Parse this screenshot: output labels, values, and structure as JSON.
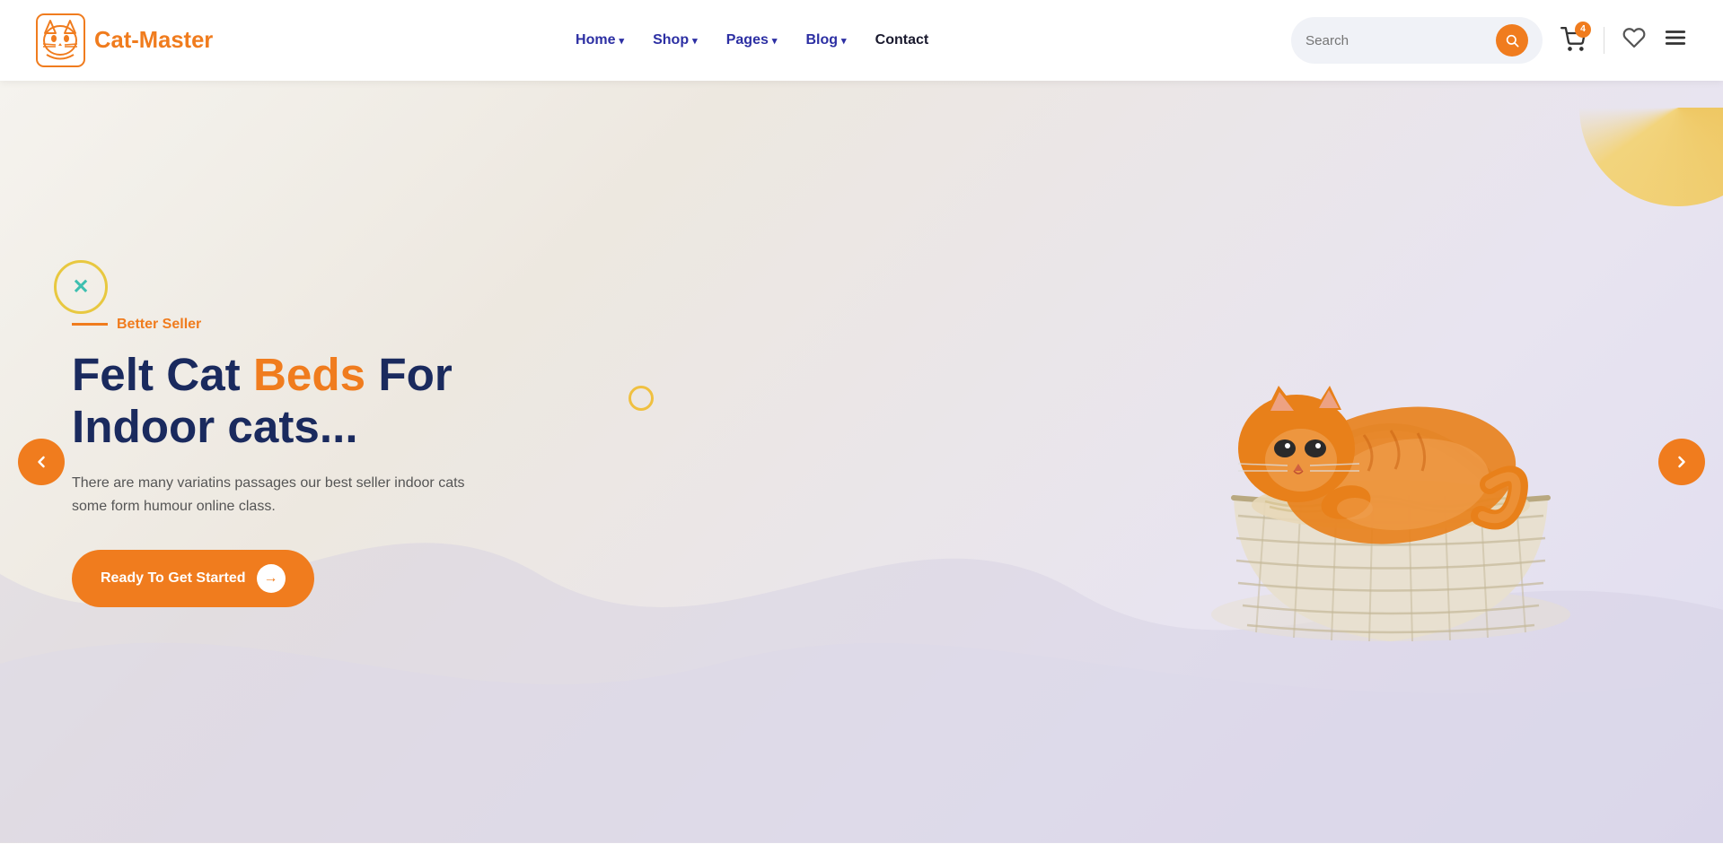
{
  "header": {
    "logo_text": "Cat-Master",
    "nav_items": [
      {
        "label": "Home",
        "has_dropdown": true
      },
      {
        "label": "Shop",
        "has_dropdown": true
      },
      {
        "label": "Pages",
        "has_dropdown": true
      },
      {
        "label": "Blog",
        "has_dropdown": true
      },
      {
        "label": "Contact",
        "has_dropdown": false
      }
    ],
    "search_placeholder": "Search",
    "cart_count": "4",
    "icons": {
      "search": "🔍",
      "cart": "🛒",
      "heart": "♡",
      "menu": "☰"
    }
  },
  "hero": {
    "badge_text": "Better Seller",
    "title_part1": "Felt Cat ",
    "title_highlight": "Beds",
    "title_part2": " For",
    "title_line2": "Indoor cats...",
    "description": "There are many variatins passages our best seller indoor cats some form humour online class.",
    "cta_label": "Ready To Get Started",
    "slider_left": "‹",
    "slider_right": "›"
  }
}
